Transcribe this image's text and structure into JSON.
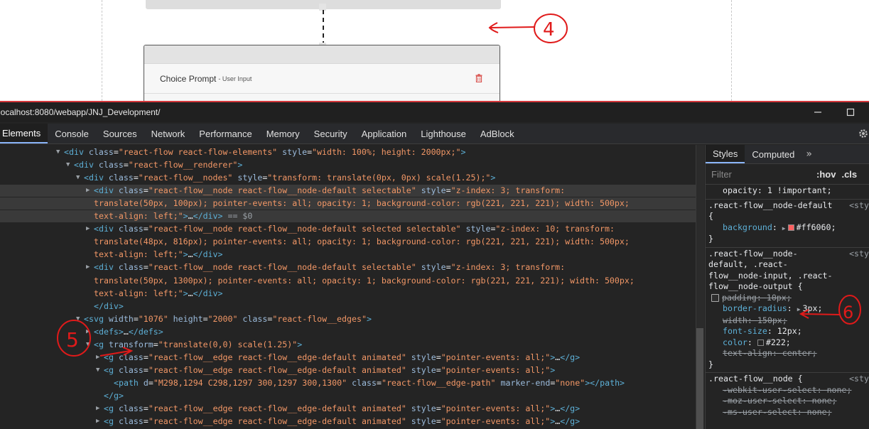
{
  "preview": {
    "node_prompt_title": "Choice Prompt",
    "node_prompt_subtitle": "- User Input",
    "annotations": [
      "4",
      "5",
      "6"
    ]
  },
  "window": {
    "title": "localhost:8080/webapp/JNJ_Development/",
    "minimize_label": "—",
    "maximize_label": "☐"
  },
  "tabs": [
    "Elements",
    "Console",
    "Sources",
    "Network",
    "Performance",
    "Memory",
    "Security",
    "Application",
    "Lighthouse",
    "AdBlock"
  ],
  "dom_lines": [
    {
      "indent": 10,
      "t": "▼",
      "html": [
        [
          "tg",
          "<div "
        ],
        [
          "an",
          "class"
        ],
        [
          "tx",
          "="
        ],
        [
          "av",
          "\"react-flow react-flow-elements\""
        ],
        [
          "tx",
          " "
        ],
        [
          "an",
          "style"
        ],
        [
          "tx",
          "="
        ],
        [
          "av",
          "\"width: 100%; height: 2000px;\""
        ],
        [
          "tg",
          ">"
        ]
      ]
    },
    {
      "indent": 12,
      "t": "▼",
      "html": [
        [
          "tg",
          "<div "
        ],
        [
          "an",
          "class"
        ],
        [
          "tx",
          "="
        ],
        [
          "av",
          "\"react-flow__renderer\""
        ],
        [
          "tg",
          ">"
        ]
      ]
    },
    {
      "indent": 14,
      "t": "▼",
      "html": [
        [
          "tg",
          "<div "
        ],
        [
          "an",
          "class"
        ],
        [
          "tx",
          "="
        ],
        [
          "av",
          "\"react-flow__nodes\""
        ],
        [
          "tx",
          " "
        ],
        [
          "an",
          "style"
        ],
        [
          "tx",
          "="
        ],
        [
          "av",
          "\"transform: translate(0px, 0px) scale(1.25);\""
        ],
        [
          "tg",
          ">"
        ]
      ]
    },
    {
      "indent": 16,
      "t": "▶",
      "hl": true,
      "html": [
        [
          "tg",
          "<div "
        ],
        [
          "an",
          "class"
        ],
        [
          "tx",
          "="
        ],
        [
          "av",
          "\"react-flow__node react-flow__node-default selectable\""
        ],
        [
          "tx",
          " "
        ],
        [
          "an",
          "style"
        ],
        [
          "tx",
          "="
        ],
        [
          "av",
          "\"z-index: 3; transform:"
        ]
      ]
    },
    {
      "indent": 16,
      "t": "",
      "hl": true,
      "html": [
        [
          "av",
          "translate(50px, 100px); pointer-events: all; opacity: 1; background-color: rgb(221, 221, 221); width: 500px;"
        ]
      ]
    },
    {
      "indent": 16,
      "t": "",
      "hl": true,
      "html": [
        [
          "av",
          "text-align: left;\""
        ],
        [
          "tg",
          ">"
        ],
        [
          "tx",
          "…"
        ],
        [
          "tg",
          "</div>"
        ],
        [
          "dollar",
          " == $0"
        ]
      ]
    },
    {
      "indent": 16,
      "t": "▶",
      "html": [
        [
          "tg",
          "<div "
        ],
        [
          "an",
          "class"
        ],
        [
          "tx",
          "="
        ],
        [
          "av",
          "\"react-flow__node react-flow__node-default selected selectable\""
        ],
        [
          "tx",
          " "
        ],
        [
          "an",
          "style"
        ],
        [
          "tx",
          "="
        ],
        [
          "av",
          "\"z-index: 10; transform:"
        ]
      ]
    },
    {
      "indent": 16,
      "t": "",
      "html": [
        [
          "av",
          "translate(48px, 816px); pointer-events: all; opacity: 1; background-color: rgb(221, 221, 221); width: 500px;"
        ]
      ]
    },
    {
      "indent": 16,
      "t": "",
      "html": [
        [
          "av",
          "text-align: left;\""
        ],
        [
          "tg",
          ">"
        ],
        [
          "tx",
          "…"
        ],
        [
          "tg",
          "</div>"
        ]
      ]
    },
    {
      "indent": 16,
      "t": "▶",
      "html": [
        [
          "tg",
          "<div "
        ],
        [
          "an",
          "class"
        ],
        [
          "tx",
          "="
        ],
        [
          "av",
          "\"react-flow__node react-flow__node-default selectable\""
        ],
        [
          "tx",
          " "
        ],
        [
          "an",
          "style"
        ],
        [
          "tx",
          "="
        ],
        [
          "av",
          "\"z-index: 3; transform:"
        ]
      ]
    },
    {
      "indent": 16,
      "t": "",
      "html": [
        [
          "av",
          "translate(50px, 1300px); pointer-events: all; opacity: 1; background-color: rgb(221, 221, 221); width: 500px;"
        ]
      ]
    },
    {
      "indent": 16,
      "t": "",
      "html": [
        [
          "av",
          "text-align: left;\""
        ],
        [
          "tg",
          ">"
        ],
        [
          "tx",
          "…"
        ],
        [
          "tg",
          "</div>"
        ]
      ]
    },
    {
      "indent": 16,
      "t": "",
      "html": [
        [
          "tg",
          "</div>"
        ]
      ]
    },
    {
      "indent": 14,
      "t": "▼",
      "html": [
        [
          "tg",
          "<svg "
        ],
        [
          "an",
          "width"
        ],
        [
          "tx",
          "="
        ],
        [
          "av",
          "\"1076\""
        ],
        [
          "tx",
          " "
        ],
        [
          "an",
          "height"
        ],
        [
          "tx",
          "="
        ],
        [
          "av",
          "\"2000\""
        ],
        [
          "tx",
          " "
        ],
        [
          "an",
          "class"
        ],
        [
          "tx",
          "="
        ],
        [
          "av",
          "\"react-flow__edges\""
        ],
        [
          "tg",
          ">"
        ]
      ]
    },
    {
      "indent": 16,
      "t": "▶",
      "html": [
        [
          "tg",
          "<defs>"
        ],
        [
          "tx",
          "…"
        ],
        [
          "tg",
          "</defs>"
        ]
      ]
    },
    {
      "indent": 16,
      "t": "▼",
      "html": [
        [
          "tg",
          "<g "
        ],
        [
          "an",
          "transform"
        ],
        [
          "tx",
          "="
        ],
        [
          "av",
          "\"translate(0,0) scale(1.25)\""
        ],
        [
          "tg",
          ">"
        ]
      ]
    },
    {
      "indent": 18,
      "t": "▶",
      "html": [
        [
          "tg",
          "<g "
        ],
        [
          "an",
          "class"
        ],
        [
          "tx",
          "="
        ],
        [
          "av",
          "\"react-flow__edge react-flow__edge-default animated\""
        ],
        [
          "tx",
          " "
        ],
        [
          "an",
          "style"
        ],
        [
          "tx",
          "="
        ],
        [
          "av",
          "\"pointer-events: all;\""
        ],
        [
          "tg",
          ">"
        ],
        [
          "tx",
          "…"
        ],
        [
          "tg",
          "</g>"
        ]
      ]
    },
    {
      "indent": 18,
      "t": "▼",
      "html": [
        [
          "tg",
          "<g "
        ],
        [
          "an",
          "class"
        ],
        [
          "tx",
          "="
        ],
        [
          "av",
          "\"react-flow__edge react-flow__edge-default animated\""
        ],
        [
          "tx",
          " "
        ],
        [
          "an",
          "style"
        ],
        [
          "tx",
          "="
        ],
        [
          "av",
          "\"pointer-events: all;\""
        ],
        [
          "tg",
          ">"
        ]
      ]
    },
    {
      "indent": 20,
      "t": "",
      "html": [
        [
          "tg",
          "<path "
        ],
        [
          "an",
          "d"
        ],
        [
          "tx",
          "="
        ],
        [
          "av",
          "\"M298,1294 C298,1297 300,1297 300,1300\""
        ],
        [
          "tx",
          " "
        ],
        [
          "an",
          "class"
        ],
        [
          "tx",
          "="
        ],
        [
          "av",
          "\"react-flow__edge-path\""
        ],
        [
          "tx",
          " "
        ],
        [
          "an",
          "marker-end"
        ],
        [
          "tx",
          "="
        ],
        [
          "av",
          "\"none\""
        ],
        [
          "tg",
          "></path>"
        ]
      ]
    },
    {
      "indent": 18,
      "t": "",
      "html": [
        [
          "tg",
          "</g>"
        ]
      ]
    },
    {
      "indent": 18,
      "t": "▶",
      "html": [
        [
          "tg",
          "<g "
        ],
        [
          "an",
          "class"
        ],
        [
          "tx",
          "="
        ],
        [
          "av",
          "\"react-flow__edge react-flow__edge-default animated\""
        ],
        [
          "tx",
          " "
        ],
        [
          "an",
          "style"
        ],
        [
          "tx",
          "="
        ],
        [
          "av",
          "\"pointer-events: all;\""
        ],
        [
          "tg",
          ">"
        ],
        [
          "tx",
          "…"
        ],
        [
          "tg",
          "</g>"
        ]
      ]
    },
    {
      "indent": 18,
      "t": "▶",
      "html": [
        [
          "tg",
          "<g "
        ],
        [
          "an",
          "class"
        ],
        [
          "tx",
          "="
        ],
        [
          "av",
          "\"react-flow__edge react-flow__edge-default animated\""
        ],
        [
          "tx",
          " "
        ],
        [
          "an",
          "style"
        ],
        [
          "tx",
          "="
        ],
        [
          "av",
          "\"pointer-events: all;\""
        ],
        [
          "tg",
          ">"
        ],
        [
          "tx",
          "…"
        ],
        [
          "tg",
          "</g>"
        ]
      ]
    },
    {
      "indent": 18,
      "t": "▶",
      "html": [
        [
          "tg",
          "<g "
        ],
        [
          "an",
          "class"
        ],
        [
          "tx",
          "="
        ],
        [
          "av",
          "\"react-flow__edge react-flow__edge-default animated\""
        ],
        [
          "tx",
          " "
        ],
        [
          "an",
          "style"
        ],
        [
          "tx",
          "="
        ],
        [
          "av",
          "\"pointer-events: all;\""
        ],
        [
          "tg",
          ">"
        ],
        [
          "tx",
          "…"
        ],
        [
          "tg",
          "</g>"
        ]
      ]
    }
  ],
  "styles": {
    "tabs": [
      "Styles",
      "Computed"
    ],
    "more": "»",
    "filter_placeholder": "Filter",
    "hov": ":hov",
    "cls": ".cls",
    "top_line": "opacity: 1 !important;",
    "rule1": {
      "selector": ".react-flow__node-default",
      "source": "<sty",
      "brace_open": "{",
      "prop": "background",
      "value": "#ff6060;",
      "swatch": "#ff6060",
      "brace_close": "}"
    },
    "rule2": {
      "selector_lines": [
        ".react-flow__node-",
        "default, .react-",
        "flow__node-input, .react-",
        "flow__node-output {"
      ],
      "source": "<sty",
      "props": [
        {
          "name": "padding",
          "value": "10px;",
          "struck": true,
          "checkbox": true
        },
        {
          "name": "border-radius",
          "value": "3px;",
          "struck": false,
          "caret": true
        },
        {
          "name": "width",
          "value": "150px;",
          "struck": true
        },
        {
          "name": "font-size",
          "value": "12px;",
          "struck": false
        },
        {
          "name": "color",
          "value": "#222;",
          "struck": false,
          "swatch": "#222222"
        },
        {
          "name": "text-align",
          "value": "center;",
          "struck": true
        }
      ],
      "brace_close": "}"
    },
    "rule3": {
      "selector": ".react-flow__node {",
      "source": "<sty",
      "props": [
        {
          "name": "-webkit-user-select",
          "value": "none;",
          "struck": true
        },
        {
          "name": "-moz-user-select",
          "value": "none;",
          "struck": true
        },
        {
          "name": "-ms-user-select",
          "value": "none;",
          "struck": true
        }
      ]
    }
  }
}
